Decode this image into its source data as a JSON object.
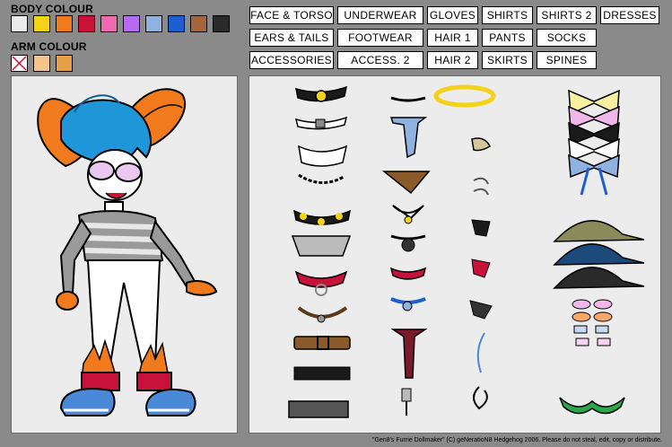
{
  "body_colour": {
    "label": "BODY COLOUR",
    "swatches": [
      "#ececec",
      "#f5d21a",
      "#f07a1c",
      "#c8123a",
      "#f06ab2",
      "#b66bf0",
      "#8fb2e0",
      "#1c5fd0",
      "#a5643a",
      "#2a2a2a"
    ]
  },
  "arm_colour": {
    "label": "ARM COLOUR",
    "swatches": [
      "none",
      "#f5c48c",
      "#e8a048"
    ]
  },
  "categories": {
    "row1": [
      "FACE & TORSO",
      "UNDERWEAR",
      "GLOVES",
      "SHIRTS",
      "SHIRTS 2",
      "DRESSES"
    ],
    "row2": [
      "EARS & TAILS",
      "FOOTWEAR",
      "HAIR 1",
      "PANTS",
      "SOCKS"
    ],
    "row3": [
      "ACCESSORIES",
      "ACCESS. 2",
      "HAIR 2",
      "SKIRTS",
      "SPINES"
    ]
  },
  "icons": {
    "character": "rabbit-character-icon",
    "collars": "collar-icon",
    "ties": "tie-icon",
    "halo": "halo-icon",
    "earrings": "earring-icon",
    "bows": "bow-icon",
    "caps": "cap-icon",
    "glasses": "glasses-icon",
    "bra": "bra-icon"
  },
  "footer": "\"Gen8's Furrie Dollmaker\" (C) geNeratioN8 Hedgehog 2006. Please do not steal, edit, copy or distribute."
}
